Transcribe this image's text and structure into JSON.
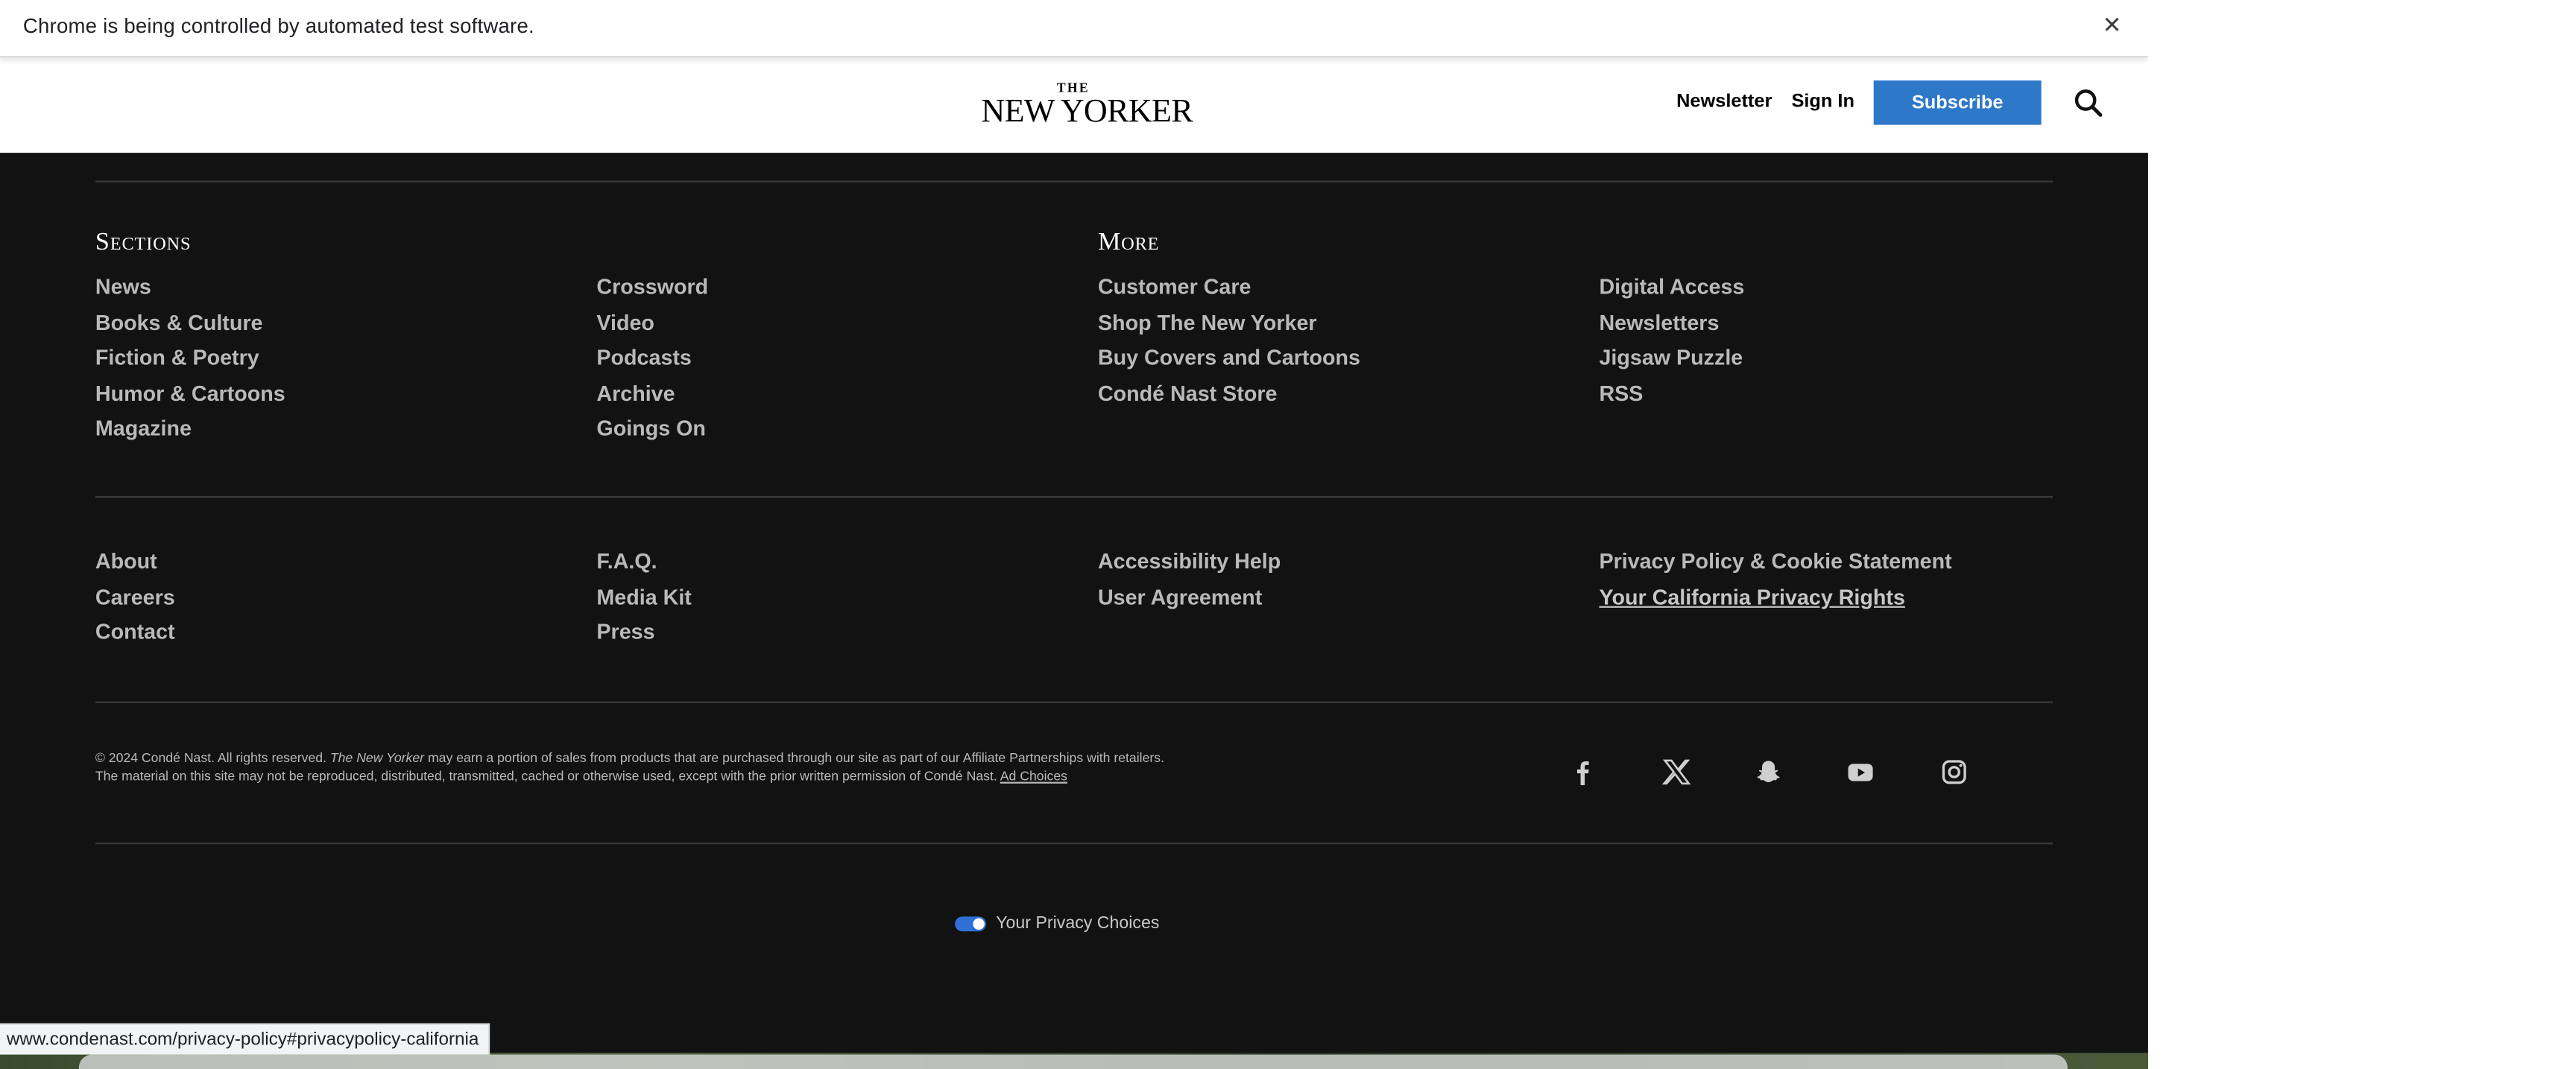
{
  "infobar": {
    "message": "Chrome is being controlled by automated test software.",
    "close_glyph": "✕"
  },
  "header": {
    "logo_the": "THE",
    "logo_name": "NEW YORKER",
    "newsletter": "Newsletter",
    "sign_in": "Sign In",
    "subscribe": "Subscribe",
    "subscribe_color": "#2e78c9"
  },
  "footer": {
    "sections_heading": "Sections",
    "more_heading": "More",
    "sections_col1": [
      "News",
      "Books & Culture",
      "Fiction & Poetry",
      "Humor & Cartoons",
      "Magazine"
    ],
    "sections_col2": [
      "Crossword",
      "Video",
      "Podcasts",
      "Archive",
      "Goings On"
    ],
    "more_col1": [
      "Customer Care",
      "Shop The New Yorker",
      "Buy Covers and Cartoons",
      "Condé Nast Store"
    ],
    "more_col2": [
      "Digital Access",
      "Newsletters",
      "Jigsaw Puzzle",
      "RSS"
    ],
    "corp_col1": [
      "About",
      "Careers",
      "Contact"
    ],
    "corp_col2": [
      "F.A.Q.",
      "Media Kit",
      "Press"
    ],
    "corp_col3": [
      "Accessibility Help",
      "User Agreement"
    ],
    "corp_col4": [
      "Privacy Policy & Cookie Statement",
      "Your California Privacy Rights"
    ],
    "legal": {
      "part1": "© 2024 Condé Nast. All rights reserved. ",
      "publication": "The New Yorker",
      "part2": " may earn a portion of sales from products that are purchased through our site as part of our Affiliate Partnerships with retailers.",
      "part3": "The material on this site may not be reproduced, distributed, transmitted, cached or otherwise used, except with the prior written permission of Condé Nast. ",
      "ad_choices": "Ad Choices"
    },
    "social_icons": [
      "facebook-icon",
      "x-icon",
      "snapchat-icon",
      "youtube-icon",
      "instagram-icon"
    ],
    "privacy_choices": "Your Privacy Choices"
  },
  "status_url": "www.condenast.com/privacy-policy#privacypolicy-california"
}
